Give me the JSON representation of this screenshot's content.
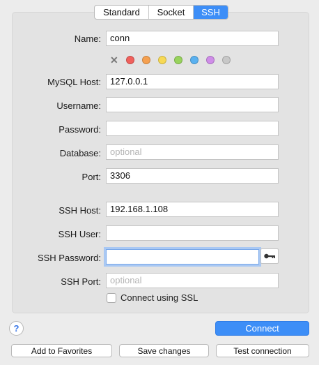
{
  "tabs": [
    "Standard",
    "Socket",
    "SSH"
  ],
  "selected_tab": "SSH",
  "form": {
    "name": {
      "label": "Name:",
      "value": "conn"
    },
    "mysql_host": {
      "label": "MySQL Host:",
      "value": "127.0.0.1"
    },
    "username": {
      "label": "Username:",
      "value": ""
    },
    "password": {
      "label": "Password:",
      "value": ""
    },
    "database": {
      "label": "Database:",
      "placeholder": "optional"
    },
    "port": {
      "label": "Port:",
      "value": "3306"
    },
    "ssh_host": {
      "label": "SSH Host:",
      "value": "192.168.1.108"
    },
    "ssh_user": {
      "label": "SSH User:",
      "value": ""
    },
    "ssh_password": {
      "label": "SSH Password:",
      "value": ""
    },
    "ssh_port": {
      "label": "SSH Port:",
      "placeholder": "optional"
    },
    "ssl": {
      "label": "Connect using SSL",
      "checked": false
    }
  },
  "colors": {
    "clear_icon": "x-mark-icon",
    "swatches": [
      "#f0605c",
      "#f5a050",
      "#f7d955",
      "#98d35d",
      "#5ab1f0",
      "#cf8de8",
      "#c8c8c8"
    ]
  },
  "buttons": {
    "help": "?",
    "connect": "Connect",
    "add_favorites": "Add to Favorites",
    "save_changes": "Save changes",
    "test_connection": "Test connection"
  },
  "accent": "#3d8ef7"
}
